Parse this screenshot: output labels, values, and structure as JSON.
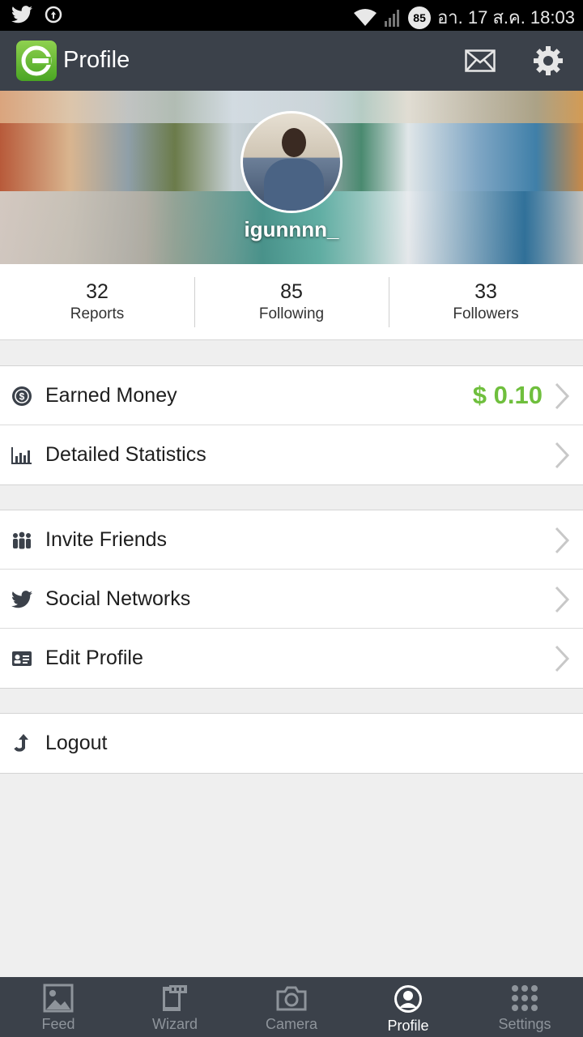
{
  "status_bar": {
    "battery_level": "85",
    "datetime": "อา. 17 ส.ค. 18:03"
  },
  "app_bar": {
    "title": "Profile"
  },
  "profile": {
    "username": "igunnnn_"
  },
  "stats": [
    {
      "value": "32",
      "label": "Reports"
    },
    {
      "value": "85",
      "label": "Following"
    },
    {
      "value": "33",
      "label": "Followers"
    }
  ],
  "menu": {
    "earned_money": {
      "label": "Earned Money",
      "value": "$ 0.10"
    },
    "detailed_statistics": {
      "label": "Detailed Statistics"
    },
    "invite_friends": {
      "label": "Invite Friends"
    },
    "social_networks": {
      "label": "Social Networks"
    },
    "edit_profile": {
      "label": "Edit Profile"
    },
    "logout": {
      "label": "Logout"
    }
  },
  "bottom_nav": [
    {
      "label": "Feed",
      "icon": "image-icon"
    },
    {
      "label": "Wizard",
      "icon": "film-icon"
    },
    {
      "label": "Camera",
      "icon": "camera-icon"
    },
    {
      "label": "Profile",
      "icon": "user-icon",
      "active": true
    },
    {
      "label": "Settings",
      "icon": "dots-grid-icon"
    }
  ],
  "colors": {
    "app_bar": "#3b414a",
    "accent_green": "#6fbf3d",
    "background": "#efefef"
  }
}
